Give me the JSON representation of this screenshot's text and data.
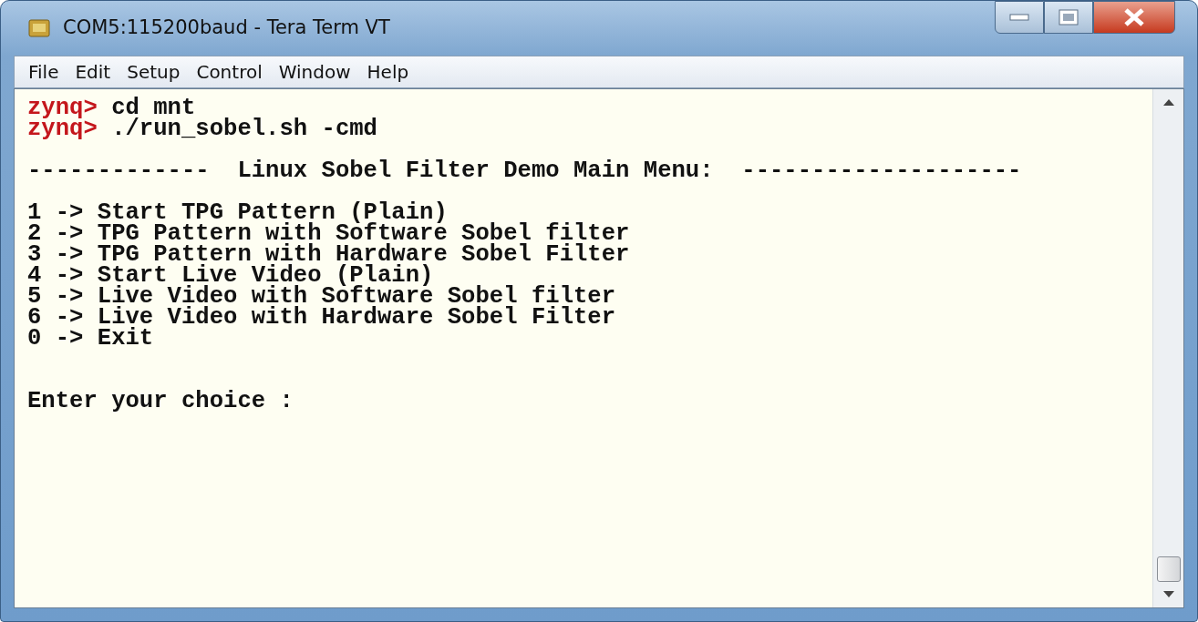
{
  "window": {
    "title": "COM5:115200baud - Tera Term VT"
  },
  "menu": [
    "File",
    "Edit",
    "Setup",
    "Control",
    "Window",
    "Help"
  ],
  "terminal": {
    "lines": [
      {
        "kind": "prompt",
        "prompt": "zynq>",
        "text": "cd mnt"
      },
      {
        "kind": "prompt",
        "prompt": "zynq>",
        "text": "./run_sobel.sh -cmd"
      },
      {
        "kind": "blank"
      },
      {
        "kind": "output",
        "text": "-------------  Linux Sobel Filter Demo Main Menu:  --------------------"
      },
      {
        "kind": "blank"
      },
      {
        "kind": "output",
        "text": "1 -> Start TPG Pattern (Plain)"
      },
      {
        "kind": "output",
        "text": "2 -> TPG Pattern with Software Sobel filter"
      },
      {
        "kind": "output",
        "text": "3 -> TPG Pattern with Hardware Sobel Filter"
      },
      {
        "kind": "output",
        "text": "4 -> Start Live Video (Plain)"
      },
      {
        "kind": "output",
        "text": "5 -> Live Video with Software Sobel filter"
      },
      {
        "kind": "output",
        "text": "6 -> Live Video with Hardware Sobel Filter"
      },
      {
        "kind": "output",
        "text": "0 -> Exit"
      },
      {
        "kind": "blank"
      },
      {
        "kind": "blank"
      },
      {
        "kind": "output",
        "text": "Enter your choice :"
      }
    ]
  }
}
